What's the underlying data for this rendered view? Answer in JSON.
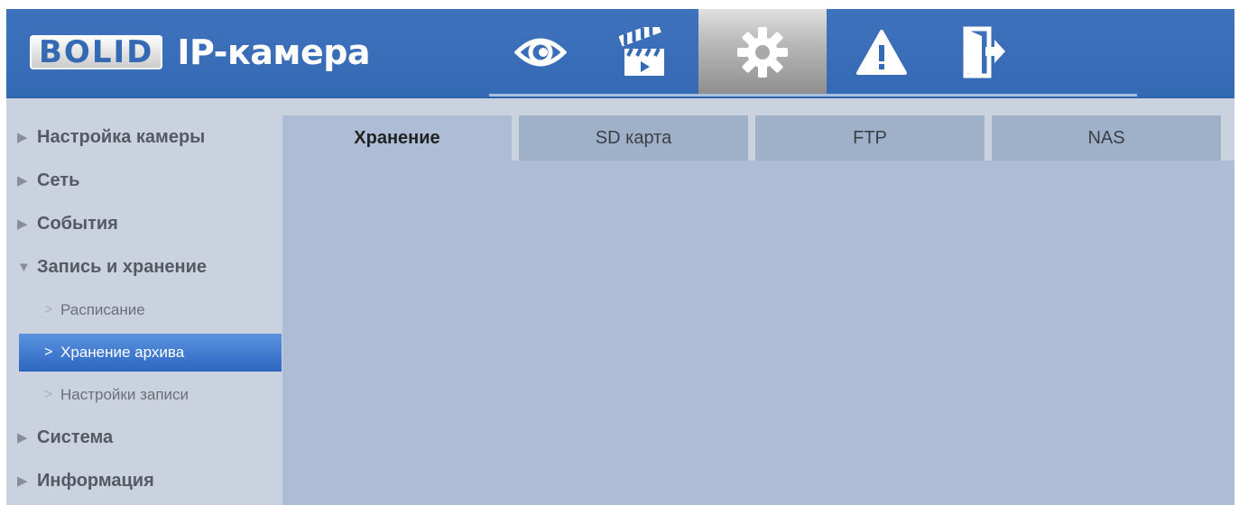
{
  "header": {
    "logo_text": "BOLID",
    "app_title": "IP-камера",
    "nav": [
      {
        "icon": "eye-icon"
      },
      {
        "icon": "clapperboard-icon"
      },
      {
        "icon": "gear-icon"
      },
      {
        "icon": "warning-icon"
      },
      {
        "icon": "exit-icon"
      }
    ],
    "active_nav": "gear-icon"
  },
  "sidebar": {
    "items": [
      {
        "label": "Настройка камеры"
      },
      {
        "label": "Сеть"
      },
      {
        "label": "События"
      },
      {
        "label": "Запись и хранение"
      },
      {
        "label": "Система"
      },
      {
        "label": "Информация"
      }
    ],
    "subitems": [
      {
        "label": "Расписание"
      },
      {
        "label": "Хранение архива"
      },
      {
        "label": "Настройки записи"
      }
    ]
  },
  "tabs": [
    {
      "label": "Хранение"
    },
    {
      "label": "SD карта"
    },
    {
      "label": "FTP"
    },
    {
      "label": "NAS"
    }
  ],
  "colors": {
    "header": "#3469b4",
    "active_sidebar": "#2c66c0",
    "content_bg": "#adbdd6"
  }
}
